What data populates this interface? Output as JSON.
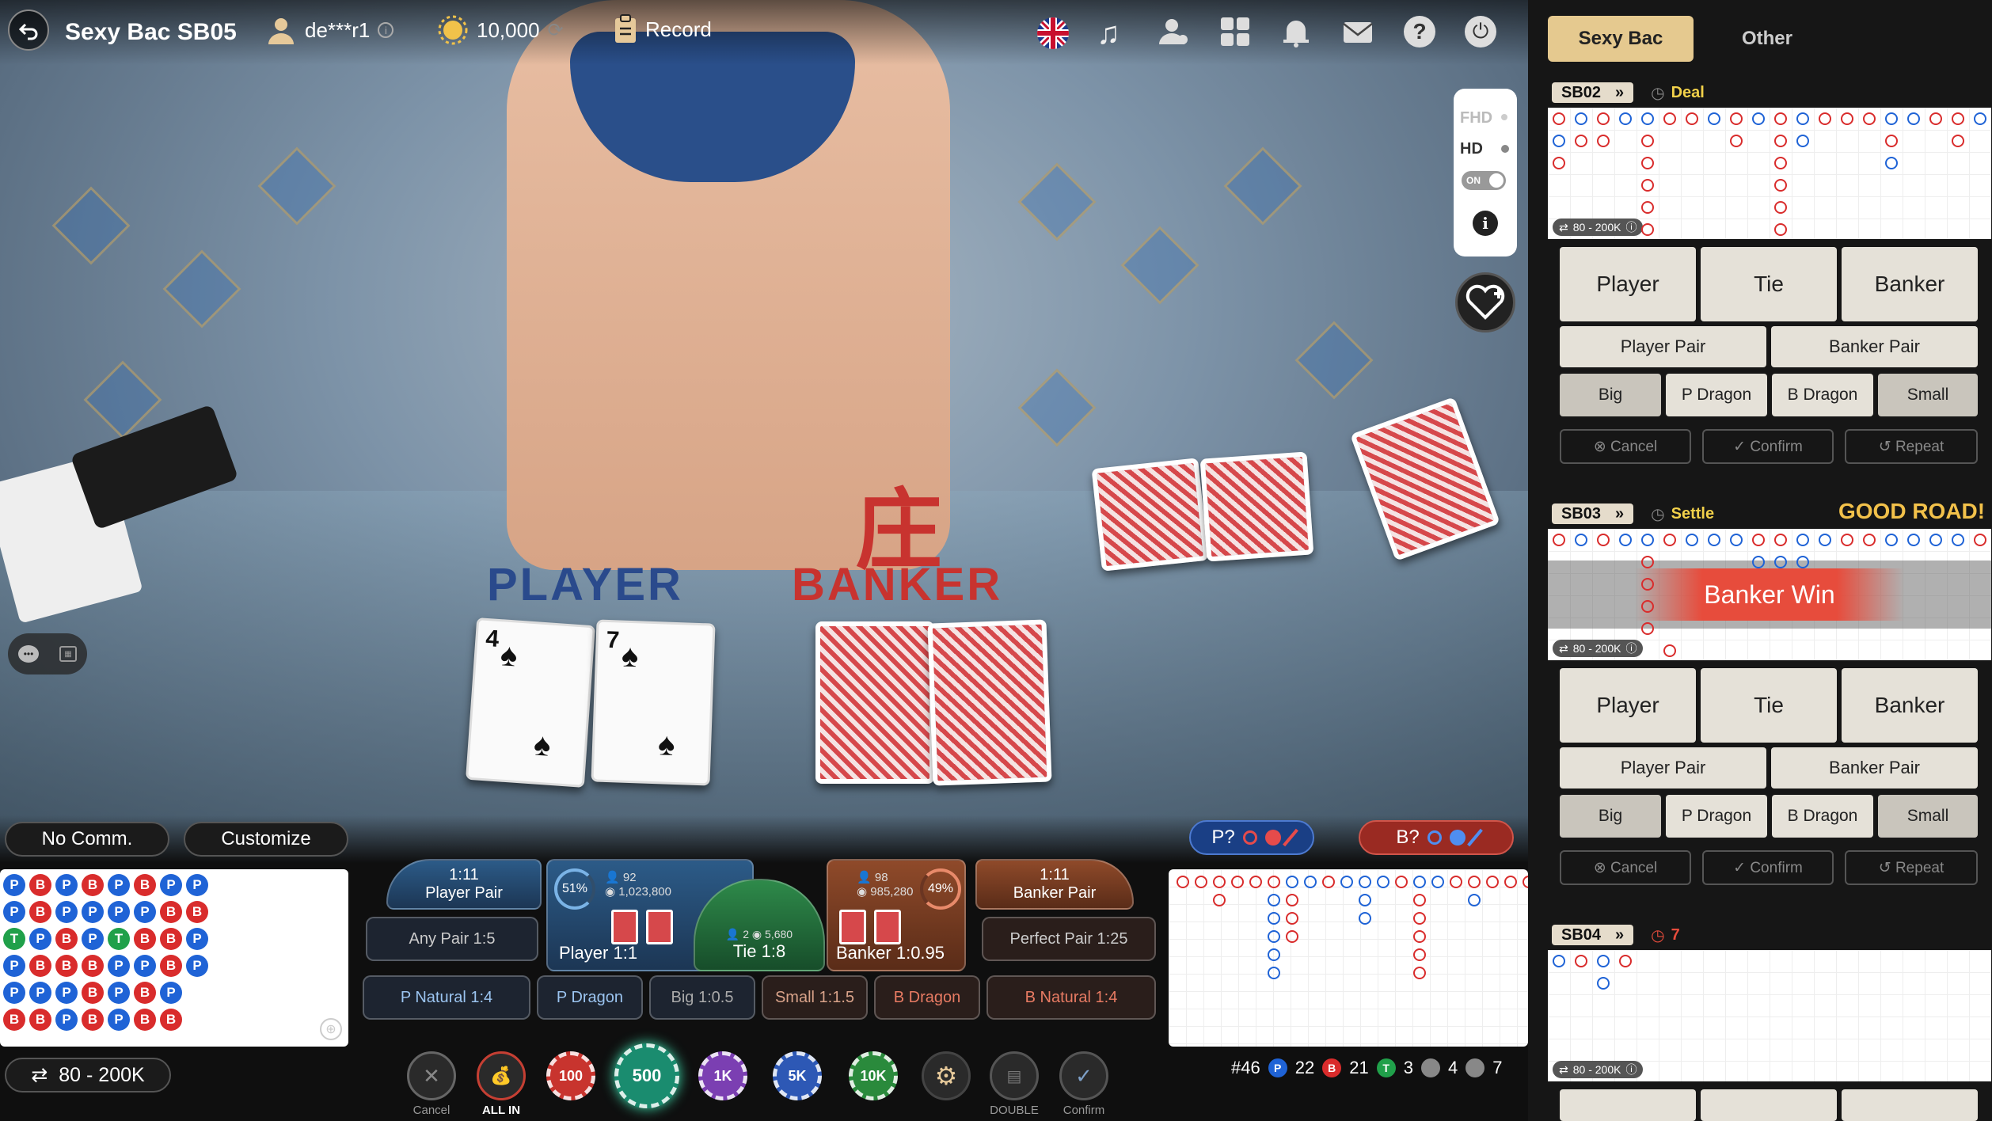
{
  "header": {
    "table_name": "Sexy Bac SB05",
    "username": "de***r1",
    "balance": "10,000",
    "record_label": "Record"
  },
  "video": {
    "cn_label": "庄",
    "player_label": "PLAYER",
    "banker_label": "BANKER",
    "quality": [
      "FHD",
      "HD"
    ],
    "toggle": "ON"
  },
  "bottom": {
    "no_comm": "No Comm.",
    "customize": "Customize",
    "limit": "80 - 200K",
    "ask_player": "P?",
    "ask_banker": "B?",
    "bead_road": [
      [
        "P",
        "P",
        "T",
        "P",
        "P",
        "B"
      ],
      [
        "B",
        "B",
        "P",
        "B",
        "P",
        "B"
      ],
      [
        "P",
        "P",
        "B",
        "B",
        "P",
        "P"
      ],
      [
        "B",
        "P",
        "P",
        "B",
        "B",
        "B"
      ],
      [
        "P",
        "P",
        "T",
        "P",
        "P",
        "P"
      ],
      [
        "B",
        "P",
        "B",
        "P",
        "B",
        "B"
      ],
      [
        "P",
        "B",
        "B",
        "B",
        "P",
        "B"
      ],
      [
        "P",
        "B",
        "P",
        "P"
      ]
    ],
    "bets": {
      "player_pair_odds": "1:11",
      "player_pair": "Player Pair",
      "banker_pair_odds": "1:11",
      "banker_pair": "Banker Pair",
      "any_pair": "Any Pair 1:5",
      "perfect_pair": "Perfect Pair 1:25",
      "player": "Player",
      "player_odds": "1:1",
      "player_pct": "51%",
      "player_users": "92",
      "player_amount": "1,023,800",
      "tie": "Tie",
      "tie_odds": "1:8",
      "tie_users": "2",
      "tie_amount": "5,680",
      "banker": "Banker",
      "banker_odds": "1:0.95",
      "banker_pct": "49%",
      "banker_users": "98",
      "banker_amount": "985,280",
      "p_natural": "P Natural 1:4",
      "p_dragon": "P Dragon",
      "big": "Big 1:0.5",
      "small": "Small 1:1.5",
      "b_dragon": "B Dragon",
      "b_natural": "B Natural 1:4"
    },
    "chips": {
      "cancel": "Cancel",
      "all_in": "ALL IN",
      "c100": "100",
      "c500": "500",
      "c1k": "1K",
      "c5k": "5K",
      "c10k": "10K",
      "double": "DOUBLE",
      "confirm": "Confirm"
    },
    "stats": {
      "round": "#46",
      "p": "22",
      "b": "21",
      "t": "3",
      "pp": "4",
      "bp": "7",
      "p_letter": "P",
      "b_letter": "B",
      "t_letter": "T"
    }
  },
  "side": {
    "tabs": [
      "Sexy Bac",
      "Other"
    ],
    "tables": [
      {
        "name": "SB02",
        "status": "Deal",
        "limit": "80 - 200K"
      },
      {
        "name": "SB03",
        "status": "Settle",
        "good_road": "GOOD ROAD!",
        "result": "Banker Win",
        "limit": "80 - 200K"
      },
      {
        "name": "SB04",
        "status": "7",
        "limit": "80 - 200K"
      }
    ],
    "buttons": {
      "player": "Player",
      "tie": "Tie",
      "banker": "Banker",
      "player_pair": "Player Pair",
      "banker_pair": "Banker Pair",
      "big": "Big",
      "p_dragon": "P Dragon",
      "b_dragon": "B Dragon",
      "small": "Small",
      "cancel": "Cancel",
      "confirm": "Confirm",
      "repeat": "Repeat"
    }
  }
}
